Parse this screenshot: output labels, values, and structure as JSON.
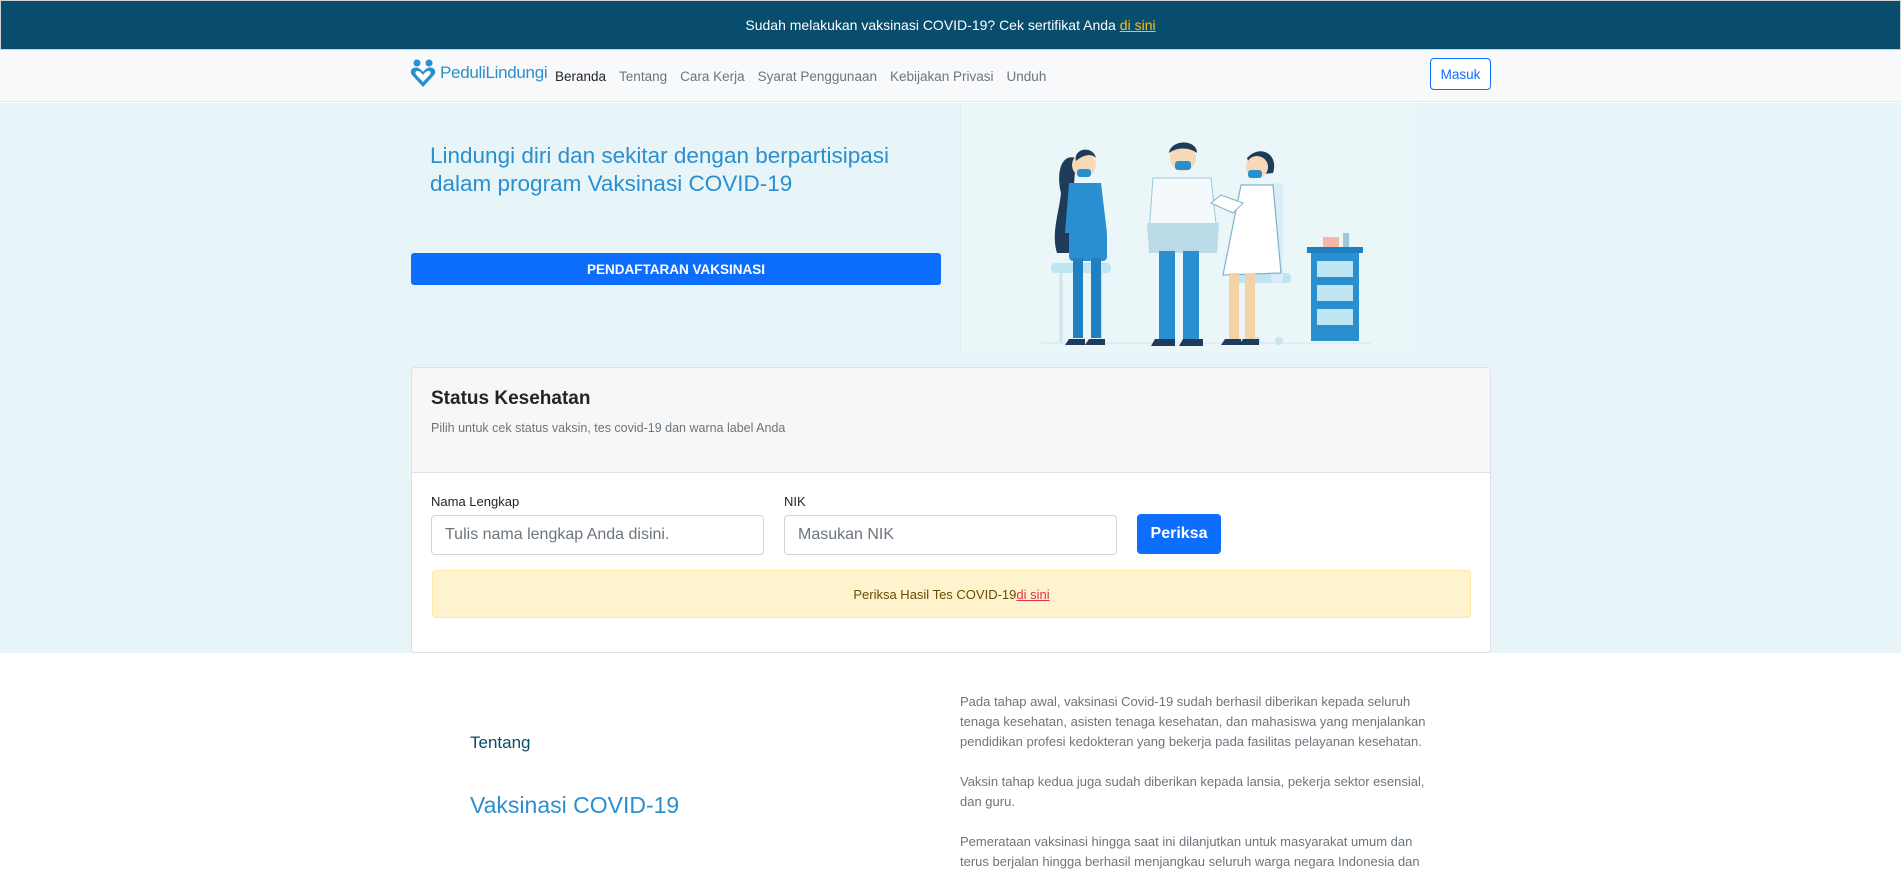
{
  "announcement": {
    "text": "Sudah melakukan vaksinasi COVID-19? Cek sertifikat Anda",
    "link": "di sini"
  },
  "nav": {
    "brand": "PeduliLindungi",
    "links": [
      "Beranda",
      "Tentang",
      "Cara Kerja",
      "Syarat Penggunaan",
      "Kebijakan Privasi",
      "Unduh"
    ],
    "active": "Beranda",
    "login": "Masuk"
  },
  "hero": {
    "title": "Lindungi diri dan sekitar dengan berpartisipasi dalam program Vaksinasi COVID-19",
    "cta": "PENDAFTARAN VAKSINASI"
  },
  "status": {
    "title": "Status Kesehatan",
    "subtitle": "Pilih untuk cek status vaksin, tes covid-19 dan warna label Anda",
    "name_label": "Nama Lengkap",
    "name_placeholder": "Tulis nama lengkap Anda disini.",
    "nik_label": "NIK",
    "nik_placeholder": "Masukan NIK",
    "button": "Periksa",
    "alert_text": "Periksa Hasil Tes COVID-19",
    "alert_link": "di sini"
  },
  "about": {
    "label": "Tentang",
    "title": "Vaksinasi COVID-19",
    "paragraphs": [
      "Pada tahap awal, vaksinasi Covid-19 sudah berhasil diberikan kepada seluruh tenaga kesehatan, asisten tenaga kesehatan, dan mahasiswa yang menjalankan pendidikan profesi kedokteran yang bekerja pada fasilitas pelayanan kesehatan.",
      "Vaksin tahap kedua juga sudah diberikan kepada lansia, pekerja sektor esensial, dan guru.",
      "Pemerataan vaksinasi hingga saat ini dilanjutkan untuk masyarakat umum dan terus berjalan hingga berhasil menjangkau seluruh warga negara Indonesia dan"
    ]
  },
  "colors": {
    "announcement_bg": "#084c6e",
    "primary": "#0d6efd",
    "brand_blue": "#2a8fd0",
    "hero_bg": "#e8f5f8",
    "alert_bg": "#fff3cd"
  }
}
